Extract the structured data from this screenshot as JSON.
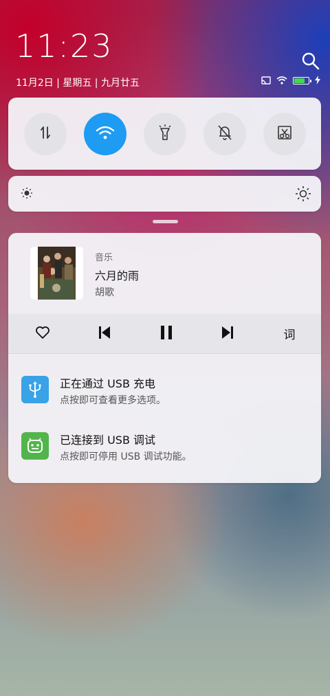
{
  "status": {
    "time": "11:23",
    "date": "11月2日 | 星期五 | 九月廿五",
    "battery_level": 0.75
  },
  "icons": {
    "search": "search-icon",
    "cast": "cast-icon",
    "wifi": "wifi-icon",
    "battery": "battery-icon",
    "charging": "charging-bolt-icon"
  },
  "quick_toggles": [
    {
      "name": "data",
      "icon": "mobile-data-icon",
      "active": false
    },
    {
      "name": "wifi",
      "icon": "wifi-icon",
      "active": true
    },
    {
      "name": "flashlight",
      "icon": "flashlight-icon",
      "active": false
    },
    {
      "name": "silent",
      "icon": "bell-off-icon",
      "active": false
    },
    {
      "name": "screenshot",
      "icon": "screenshot-icon",
      "active": false
    }
  ],
  "colors": {
    "accent": "#1e9bf2",
    "usb_blue": "#3aa2e7",
    "usb_green": "#52b54b"
  },
  "music": {
    "app": "音乐",
    "title": "六月的雨",
    "artist": "胡歌",
    "lyrics_label": "词"
  },
  "notifications": [
    {
      "title": "正在通过 USB 充电",
      "subtitle": "点按即可查看更多选项。",
      "icon": "usb-icon"
    },
    {
      "title": "已连接到 USB 调试",
      "subtitle": "点按即可停用 USB 调试功能。",
      "icon": "android-icon"
    }
  ]
}
